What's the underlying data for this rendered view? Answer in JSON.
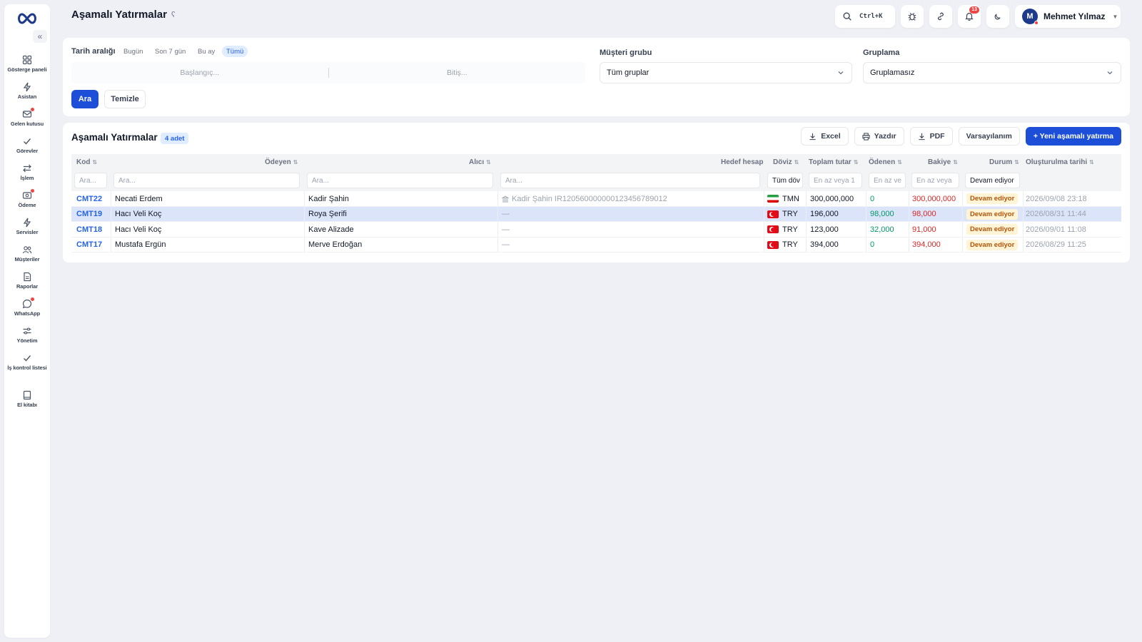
{
  "app": {
    "title": "Aşamalı Yatırmalar",
    "help_icon": "help-icon"
  },
  "sidebar": {
    "collapse": "«",
    "items": [
      {
        "label": "Gösterge paneli",
        "icon": "dashboard-icon",
        "dot": false
      },
      {
        "label": "Asistan",
        "icon": "bolt-icon",
        "dot": false
      },
      {
        "label": "Gelen kutusu",
        "icon": "inbox-icon",
        "dot": true
      },
      {
        "label": "Görevler",
        "icon": "check-icon",
        "dot": false
      },
      {
        "label": "İşlem",
        "icon": "transfer-icon",
        "dot": false
      },
      {
        "label": "Ödeme",
        "icon": "payment-icon",
        "dot": true
      },
      {
        "label": "Servisler",
        "icon": "services-icon",
        "dot": false
      },
      {
        "label": "Müşteriler",
        "icon": "users-icon",
        "dot": false
      },
      {
        "label": "Raporlar",
        "icon": "report-icon",
        "dot": false
      },
      {
        "label": "WhatsApp",
        "icon": "whatsapp-icon",
        "dot": true
      },
      {
        "label": "Yönetim",
        "icon": "settings-sliders-icon",
        "dot": false
      },
      {
        "label": "İş kontrol listesi",
        "icon": "checklist-icon",
        "dot": false
      },
      {
        "label": "El kitabı",
        "icon": "book-icon",
        "dot": false
      }
    ]
  },
  "topbar": {
    "search_shortcut": "Ctrl+K",
    "notification_count": "13",
    "user": {
      "initial": "M",
      "name": "Mehmet Yılmaz"
    }
  },
  "filters": {
    "date_label": "Tarih aralığı",
    "chips": [
      "Bugün",
      "Son 7 gün",
      "Bu ay",
      "Tümü"
    ],
    "active_chip": "Tümü",
    "start_placeholder": "Başlangıç...",
    "end_placeholder": "Bitiş...",
    "group_label": "Müşteri grubu",
    "group_value": "Tüm gruplar",
    "grouping_label": "Gruplama",
    "grouping_value": "Gruplamasız",
    "search_button": "Ara",
    "clear_button": "Temizle"
  },
  "table": {
    "title": "Aşamalı Yatırmalar",
    "count": "4 adet",
    "actions": {
      "excel": "Excel",
      "print": "Yazdır",
      "pdf": "PDF",
      "default": "Varsayılanım",
      "new": "+ Yeni aşamalı yatırma"
    },
    "columns": [
      "Kod",
      "Ödeyen",
      "Alıcı",
      "Hedef hesap",
      "Döviz",
      "Toplam tutar",
      "Ödenen",
      "Bakiye",
      "Durum",
      "Oluşturulma tarihi"
    ],
    "column_filters": {
      "kod": "Ara...",
      "odeyen": "Ara...",
      "alici": "Ara...",
      "hedef": "Ara...",
      "doviz": "Tüm döv",
      "toplam": "En az veya 1",
      "odenen": "En az ve",
      "bakiye": "En az veya",
      "durum": "Devam ediyor"
    },
    "rows": [
      {
        "code": "CMT22",
        "payer": "Necati Erdem",
        "receiver": "Kadir Şahin",
        "target": "Kadir Şahin IR120560000000123456789012",
        "currency": "TMN",
        "flag": "ir",
        "total": "300,000,000",
        "paid": "0",
        "balance": "300,000,000",
        "status": "Devam ediyor",
        "created": "2026/09/08 23:18",
        "selected": false
      },
      {
        "code": "CMT19",
        "payer": "Hacı Veli Koç",
        "receiver": "Roya Şerifi",
        "target": "—",
        "currency": "TRY",
        "flag": "tr",
        "total": "196,000",
        "paid": "98,000",
        "balance": "98,000",
        "status": "Devam ediyor",
        "created": "2026/08/31 11:44",
        "selected": true
      },
      {
        "code": "CMT18",
        "payer": "Hacı Veli Koç",
        "receiver": "Kave Alizade",
        "target": "—",
        "currency": "TRY",
        "flag": "tr",
        "total": "123,000",
        "paid": "32,000",
        "balance": "91,000",
        "status": "Devam ediyor",
        "created": "2026/09/01 11:08",
        "selected": false
      },
      {
        "code": "CMT17",
        "payer": "Mustafa Ergün",
        "receiver": "Merve Erdoğan",
        "target": "—",
        "currency": "TRY",
        "flag": "tr",
        "total": "394,000",
        "paid": "0",
        "balance": "394,000",
        "status": "Devam ediyor",
        "created": "2026/08/29 11:25",
        "selected": false
      }
    ]
  },
  "colors": {
    "primary": "#1d4ed8",
    "accent_light": "#e0ecff",
    "danger": "#dc2626",
    "success": "#059669",
    "status_bg": "#fff4d6",
    "status_fg": "#b45309"
  }
}
